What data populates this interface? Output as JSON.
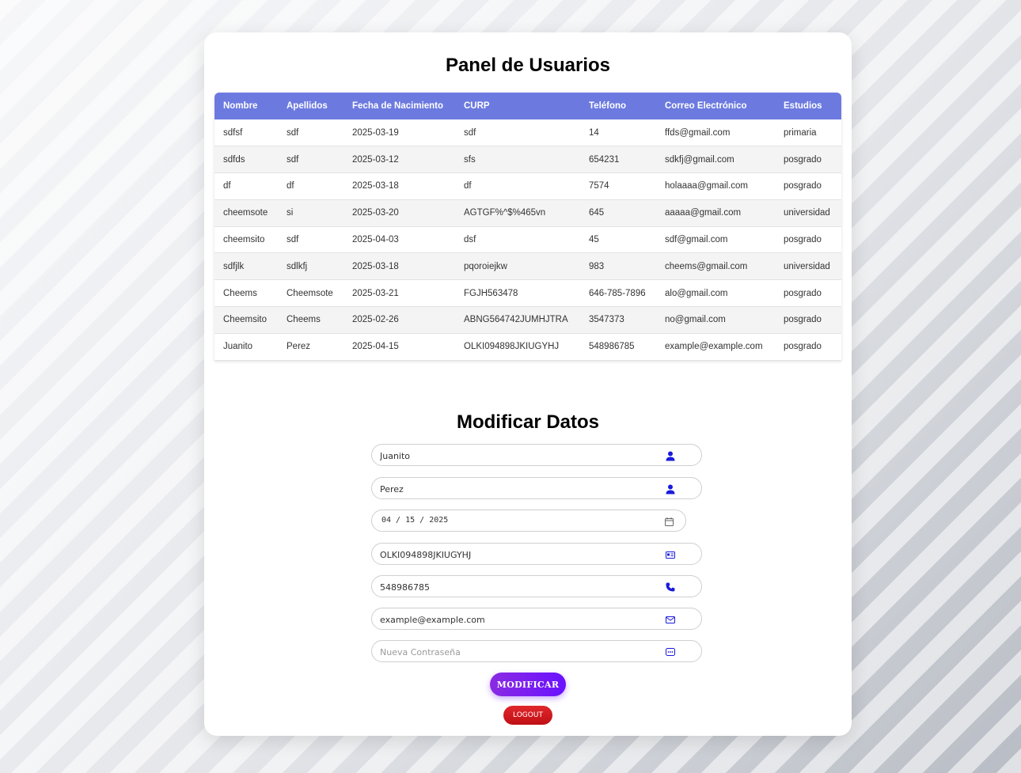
{
  "panel": {
    "title": "Panel de Usuarios",
    "columns": [
      "Nombre",
      "Apellidos",
      "Fecha de Nacimiento",
      "CURP",
      "Teléfono",
      "Correo Electrónico",
      "Estudios"
    ],
    "rows": [
      [
        "sdfsf",
        "sdf",
        "2025-03-19",
        "sdf",
        "14",
        "ffds@gmail.com",
        "primaria"
      ],
      [
        "sdfds",
        "sdf",
        "2025-03-12",
        "sfs",
        "654231",
        "sdkfj@gmail.com",
        "posgrado"
      ],
      [
        "df",
        "df",
        "2025-03-18",
        "df",
        "7574",
        "holaaaa@gmail.com",
        "posgrado"
      ],
      [
        "cheemsote",
        "si",
        "2025-03-20",
        "AGTGF%^$%465vn",
        "645",
        "aaaaa@gmail.com",
        "universidad"
      ],
      [
        "cheemsito",
        "sdf",
        "2025-04-03",
        "dsf",
        "45",
        "sdf@gmail.com",
        "posgrado"
      ],
      [
        "sdfjlk",
        "sdlkfj",
        "2025-03-18",
        "pqoroiejkw",
        "983",
        "cheems@gmail.com",
        "universidad"
      ],
      [
        "Cheems",
        "Cheemsote",
        "2025-03-21",
        "FGJH563478",
        "646-785-7896",
        "alo@gmail.com",
        "posgrado"
      ],
      [
        "Cheemsito",
        "Cheems",
        "2025-02-26",
        "ABNG564742JUMHJTRA",
        "3547373",
        "no@gmail.com",
        "posgrado"
      ],
      [
        "Juanito",
        "Perez",
        "2025-04-15",
        "OLKI094898JKIUGYHJ",
        "548986785",
        "example@example.com",
        "posgrado"
      ]
    ]
  },
  "form": {
    "title": "Modificar Datos",
    "nombre": "Juanito",
    "apellidos": "Perez",
    "fecha": "04 / 15 / 2025",
    "curp": "OLKI094898JKIUGYHJ",
    "telefono": "548986785",
    "correo": "example@example.com",
    "password_placeholder": "Nueva Contraseña",
    "submit_label": "MODIFICAR",
    "logout_label": "LOGOUT"
  },
  "colors": {
    "table_header": "#6c7ae0",
    "icon_blue": "#1a1adb",
    "submit": "#7a1ff0",
    "logout": "#d11a1f"
  },
  "icons": {
    "nombre": "user-icon",
    "apellidos": "user-icon",
    "fecha": "calendar-icon",
    "curp": "id-card-icon",
    "telefono": "phone-icon",
    "correo": "envelope-icon",
    "password": "password-dots-icon"
  }
}
